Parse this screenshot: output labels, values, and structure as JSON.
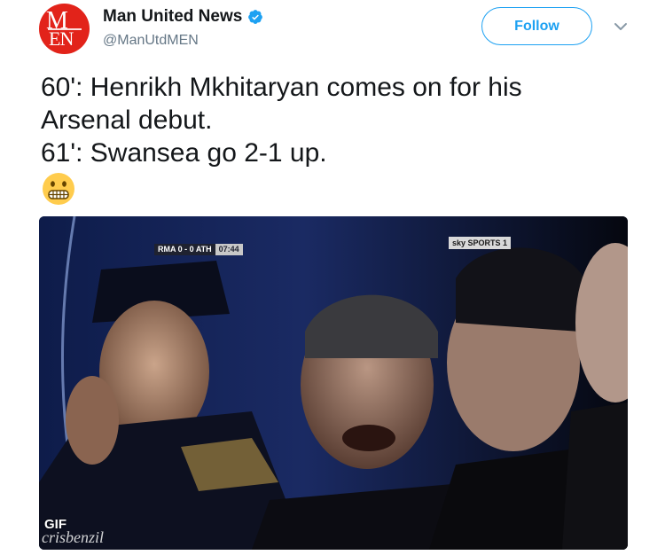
{
  "account": {
    "display_name": "Man United News",
    "handle": "@ManUtdMEN",
    "avatar_monogram": "MEN",
    "verified": true,
    "avatar_color": "#e2231a"
  },
  "actions": {
    "follow_label": "Follow",
    "accent_color": "#1da1f2"
  },
  "tweet": {
    "lines": [
      "60': Henrikh Mkhitaryan comes on for his",
      "Arsenal debut.",
      "61': Swansea go 2-1 up."
    ],
    "emoji": "grimacing-face-emoji"
  },
  "media": {
    "type": "gif",
    "badge": "GIF",
    "watermark": "crisbenzil",
    "score_overlay": "RMA 0 - 0 ATH",
    "clock_overlay": "07:44",
    "channel_overlay": "sky SPORTS 1"
  }
}
